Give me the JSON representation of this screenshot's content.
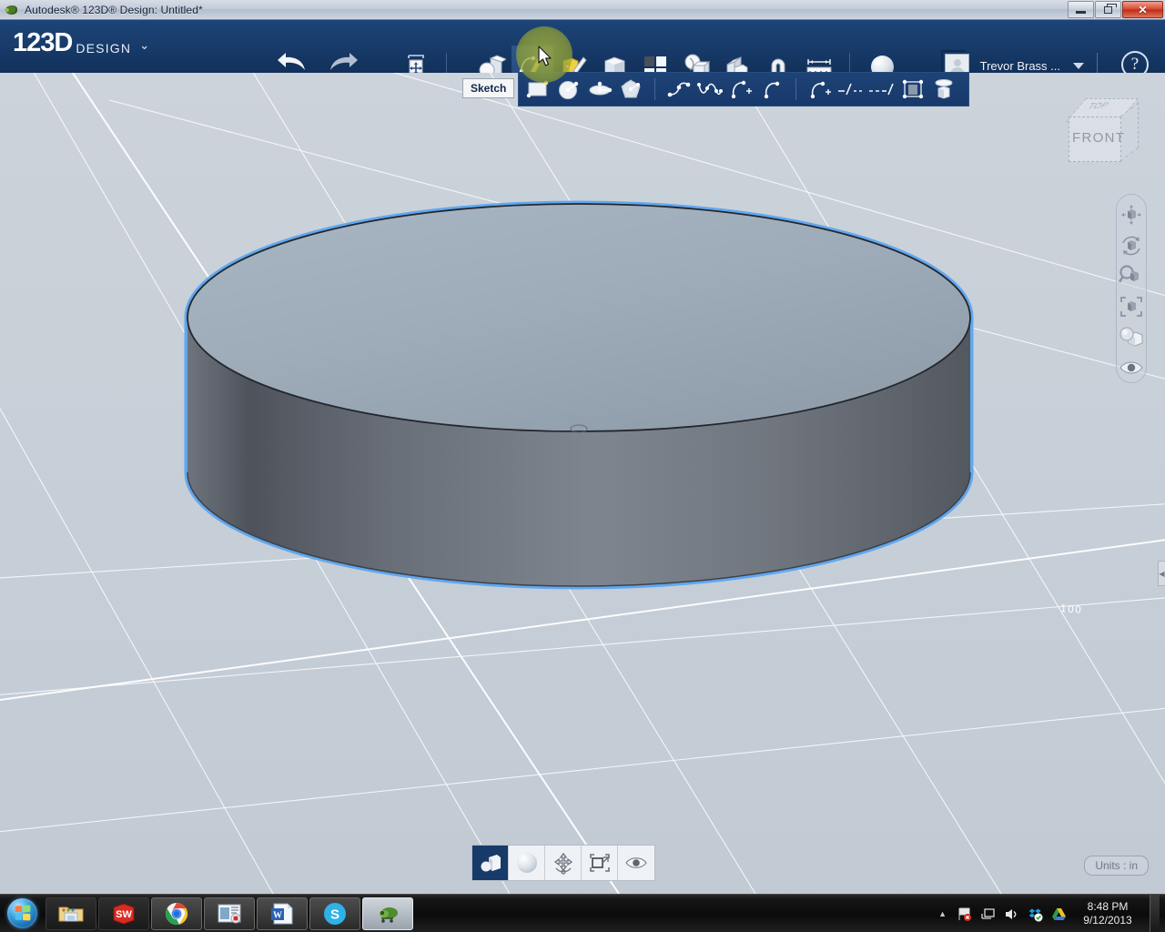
{
  "window": {
    "title": "Autodesk® 123D® Design: Untitled*",
    "minimize_label": "Minimize",
    "restore_label": "Restore",
    "close_label": "✕"
  },
  "appbar": {
    "logo_main": "123D",
    "logo_sub": "DESIGN",
    "logo_caret": "⌄",
    "undo_label": "Undo",
    "redo_label": "Redo",
    "transform_label": "Transform",
    "tools": [
      {
        "name": "primitives",
        "label": "Primitives"
      },
      {
        "name": "sketch",
        "label": "Sketch",
        "active": true
      },
      {
        "name": "construct",
        "label": "Construct"
      },
      {
        "name": "modify",
        "label": "Modify"
      },
      {
        "name": "pattern",
        "label": "Pattern"
      },
      {
        "name": "grouping",
        "label": "Grouping"
      },
      {
        "name": "combine",
        "label": "Combine"
      },
      {
        "name": "magnet",
        "label": "Snap"
      },
      {
        "name": "measure",
        "label": "Measure"
      },
      {
        "name": "material",
        "label": "Material"
      }
    ],
    "user_name": "Trevor Brass ...",
    "help_label": "?"
  },
  "sketch_flyout": {
    "tooltip": "Sketch",
    "items": [
      {
        "name": "sketch-rectangle",
        "label": "Rectangle"
      },
      {
        "name": "sketch-circle",
        "label": "Circle"
      },
      {
        "name": "sketch-ellipse",
        "label": "Ellipse"
      },
      {
        "name": "sketch-polygon",
        "label": "Polygon"
      },
      {
        "name": "sketch-polyline",
        "label": "Polyline"
      },
      {
        "name": "sketch-spline",
        "label": "Spline"
      },
      {
        "name": "sketch-two-point-arc",
        "label": "Two Point Arc"
      },
      {
        "name": "sketch-three-point-arc",
        "label": "Three Point Arc"
      },
      {
        "name": "sketch-fillet",
        "label": "Fillet"
      },
      {
        "name": "sketch-trim",
        "label": "Trim"
      },
      {
        "name": "sketch-extend",
        "label": "Extend"
      },
      {
        "name": "sketch-offset",
        "label": "Offset"
      },
      {
        "name": "sketch-project",
        "label": "Project"
      }
    ]
  },
  "viewport": {
    "grid_label": "100",
    "viewcube": {
      "top_face": "TOP",
      "front_face": "FRONT"
    },
    "model": {
      "shape": "cylinder",
      "selected": true,
      "top_face_color": "#9fadbc",
      "side_light_color": "#7e8591",
      "side_dark_color": "#5e636c",
      "selection_color": "#5ba4f0",
      "edge_color": "#2a2e34"
    },
    "background_color": "#c8d0d9",
    "grid_line_color": "#ffffff"
  },
  "nav_toolbar": [
    {
      "name": "pan",
      "label": "Pan"
    },
    {
      "name": "orbit",
      "label": "Orbit"
    },
    {
      "name": "zoom",
      "label": "Zoom"
    },
    {
      "name": "fit",
      "label": "Fit"
    },
    {
      "name": "view-style",
      "label": "View Style"
    },
    {
      "name": "visibility",
      "label": "Visibility"
    }
  ],
  "bottom_toolbar": {
    "buttons": [
      {
        "name": "display-mode",
        "label": "Display Mode",
        "active": true
      },
      {
        "name": "material",
        "label": "Material",
        "active": false
      },
      {
        "name": "grid-snap",
        "label": "Grid / Snap",
        "active": false
      },
      {
        "name": "fit-scene",
        "label": "Fit Scene",
        "active": false
      },
      {
        "name": "visibility",
        "label": "Visibility",
        "active": false
      }
    ]
  },
  "status": {
    "units": "Units : in",
    "panel_handle": "◀"
  },
  "taskbar": {
    "start_label": "Start",
    "items": [
      {
        "name": "windows-explorer",
        "label": "Windows Explorer",
        "state": "pinned"
      },
      {
        "name": "solidworks",
        "label": "SolidWorks",
        "state": "pinned"
      },
      {
        "name": "google-chrome",
        "label": "Google Chrome",
        "state": "running"
      },
      {
        "name": "media-player",
        "label": "Media Player",
        "state": "running"
      },
      {
        "name": "microsoft-word",
        "label": "Microsoft Word",
        "state": "running"
      },
      {
        "name": "skype",
        "label": "Skype",
        "state": "running"
      },
      {
        "name": "autodesk-123d-design",
        "label": "Autodesk 123D Design",
        "state": "focus"
      }
    ],
    "tray": [
      {
        "name": "tray-overflow",
        "label": "Show hidden icons"
      },
      {
        "name": "tray-flag-action-center",
        "label": "Action Center"
      },
      {
        "name": "tray-network",
        "label": "Network"
      },
      {
        "name": "tray-volume",
        "label": "Volume"
      },
      {
        "name": "tray-dropbox",
        "label": "Dropbox"
      },
      {
        "name": "tray-google-drive",
        "label": "Google Drive"
      }
    ],
    "time": "8:48 PM",
    "date": "9/12/2013"
  }
}
